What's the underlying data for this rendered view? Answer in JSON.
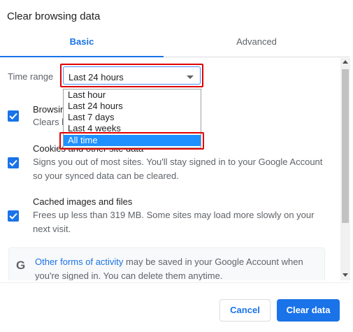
{
  "dialog": {
    "title": "Clear browsing data"
  },
  "tabs": [
    {
      "label": "Basic",
      "active": true
    },
    {
      "label": "Advanced",
      "active": false
    }
  ],
  "time_range": {
    "label": "Time range",
    "selected": "Last 24 hours",
    "options": [
      "Last hour",
      "Last 24 hours",
      "Last 7 days",
      "Last 4 weeks",
      "All time"
    ],
    "highlighted_option": "All time"
  },
  "items": [
    {
      "title": "Browsing history",
      "description": "Clears history from all signed-in devices",
      "checked": true
    },
    {
      "title": "Cookies and other site data",
      "description": "Signs you out of most sites. You'll stay signed in to your Google Account so your synced data can be cleared.",
      "checked": true
    },
    {
      "title": "Cached images and files",
      "description": "Frees up less than 319 MB. Some sites may load more slowly on your next visit.",
      "checked": true
    }
  ],
  "info": {
    "icon": "google-g-icon",
    "link_text": "Other forms of activity",
    "text": " may be saved in your Google Account when you're signed in. You can delete them anytime."
  },
  "footer": {
    "cancel_label": "Cancel",
    "clear_label": "Clear data"
  },
  "colors": {
    "accent": "#1a73e8",
    "highlight_border": "#e00000",
    "dropdown_selection": "#1e90ff"
  }
}
